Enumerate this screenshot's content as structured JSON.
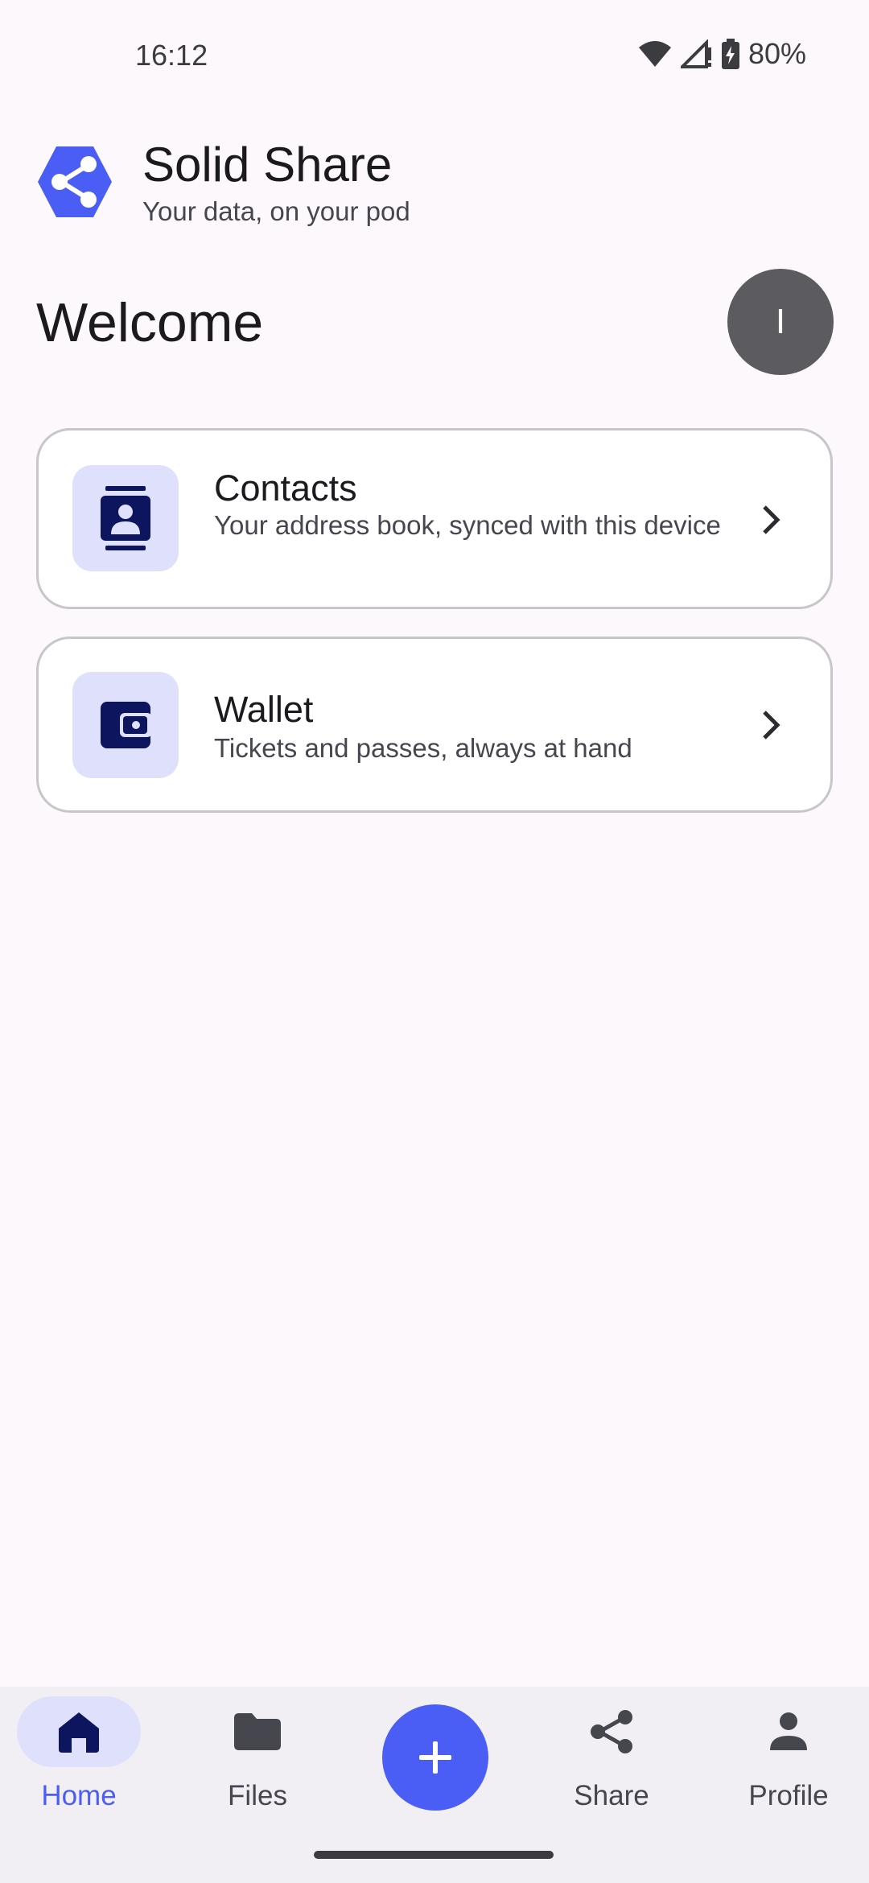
{
  "status_bar": {
    "time": "16:12",
    "battery": "80%",
    "icons": [
      "wifi-icon",
      "signal-icon",
      "battery-charging-icon"
    ]
  },
  "app": {
    "title": "Solid Share",
    "subtitle": "Your data, on your pod",
    "logo_icon": "hexagon-share-logo",
    "accent_color": "#4a5ef5"
  },
  "welcome": {
    "heading": "Welcome",
    "avatar_initial": "I"
  },
  "cards": [
    {
      "title": "Contacts",
      "description": "Your address book, synced with this device",
      "icon": "contacts-book-icon"
    },
    {
      "title": "Wallet",
      "description": "Tickets and passes, always at hand",
      "icon": "wallet-icon"
    }
  ],
  "bottom_nav": {
    "items": [
      {
        "label": "Home",
        "icon": "home-icon",
        "active": true
      },
      {
        "label": "Files",
        "icon": "folder-icon",
        "active": false
      },
      {
        "label": "Share",
        "icon": "share-icon",
        "active": false
      },
      {
        "label": "Profile",
        "icon": "person-icon",
        "active": false
      }
    ],
    "fab_icon": "plus-icon"
  }
}
